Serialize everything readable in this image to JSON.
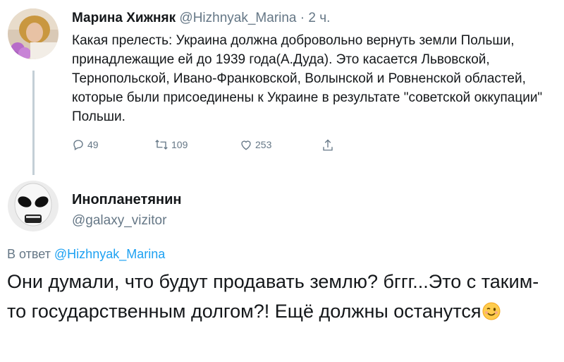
{
  "tweet1": {
    "author_name": "Марина Хижняк",
    "handle": "@Hizhnyak_Marina",
    "separator": "·",
    "time": "2 ч.",
    "text": "Какая прелесть: Украина должна добровольно вернуть земли Польши, принадлежащие ей до 1939 года(А.Дуда). Это касается Львовской, Тернопольской, Ивано-Франковской, Волынской и Ровненской областей, которые были присоединены к Украине в результате \"советской оккупации\" Польши.",
    "replies_count": "49",
    "retweets_count": "109",
    "likes_count": "253",
    "icons": [
      "reply-icon",
      "retweet-icon",
      "like-icon",
      "share-icon"
    ]
  },
  "tweet2": {
    "author_name": "Инопланетянин",
    "handle": "@galaxy_vizitor",
    "reply_prefix": "В ответ",
    "reply_handle": "@Hizhnyak_Marina",
    "text": "Они думали, что будут продавать землю? бггг...Это с таким-то государственным долгом?! Ещё должны останутся",
    "emoji": "winking-face"
  },
  "colors": {
    "text": "#14171a",
    "muted": "#657786",
    "link": "#1da1f2",
    "thread_line": "#c4cfd6"
  }
}
